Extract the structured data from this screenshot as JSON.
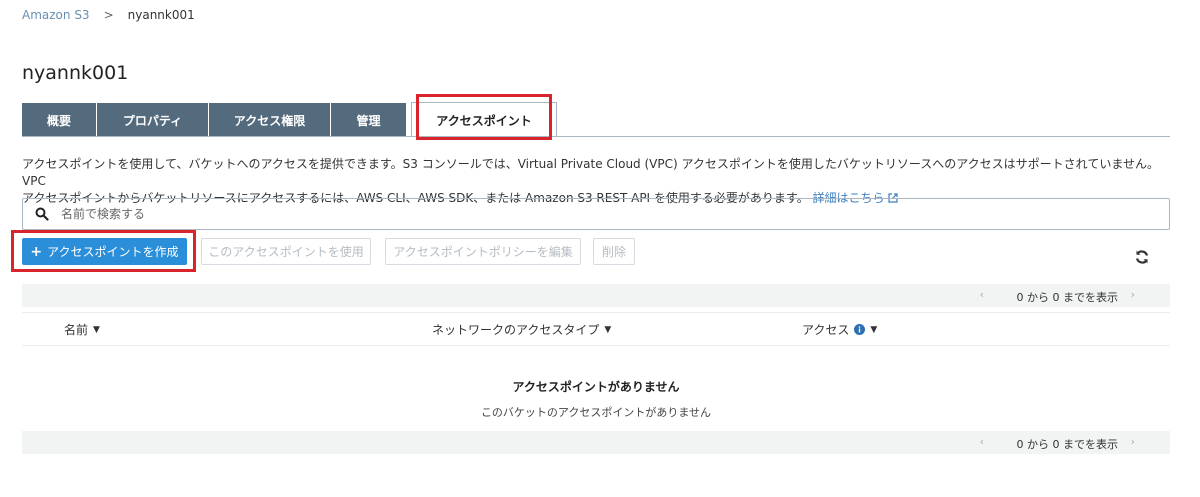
{
  "breadcrumb": {
    "root": "Amazon S3",
    "separator": ">",
    "current": "nyannk001"
  },
  "page_title": "nyannk001",
  "tabs": [
    {
      "label": "概要"
    },
    {
      "label": "プロパティ"
    },
    {
      "label": "アクセス権限"
    },
    {
      "label": "管理"
    },
    {
      "label": "アクセスポイント",
      "active": true
    }
  ],
  "description": {
    "line1": "アクセスポイントを使用して、バケットへのアクセスを提供できます。S3 コンソールでは、Virtual Private Cloud (VPC) アクセスポイントを使用したバケットリソースへのアクセスはサポートされていません。VPC",
    "line2": "アクセスポイントからバケットリソースにアクセスするには、AWS CLI、AWS SDK、または Amazon S3 REST API を使用する必要があります。",
    "link": "詳細はこちら"
  },
  "search": {
    "placeholder": "名前で検索する",
    "value": ""
  },
  "buttons": {
    "create": "アクセスポイントを作成",
    "use": "このアクセスポイントを使用",
    "edit_policy": "アクセスポイントポリシーを編集",
    "delete": "削除"
  },
  "pager": {
    "text": "0 から 0 までを表示",
    "prev": "‹",
    "next": "›"
  },
  "table": {
    "columns": {
      "name": "名前",
      "network": "ネットワークのアクセスタイプ",
      "access": "アクセス"
    },
    "empty_title": "アクセスポイントがありません",
    "empty_subtitle": "このバケットのアクセスポイントがありません"
  },
  "colors": {
    "tab_bg": "#546a7d",
    "primary": "#2b8ed8",
    "highlight": "#d9242b",
    "link": "#3a7fc1"
  },
  "icons": [
    "search-icon",
    "external-link-icon",
    "refresh-icon",
    "info-icon",
    "caret-down-icon",
    "plus-icon"
  ]
}
